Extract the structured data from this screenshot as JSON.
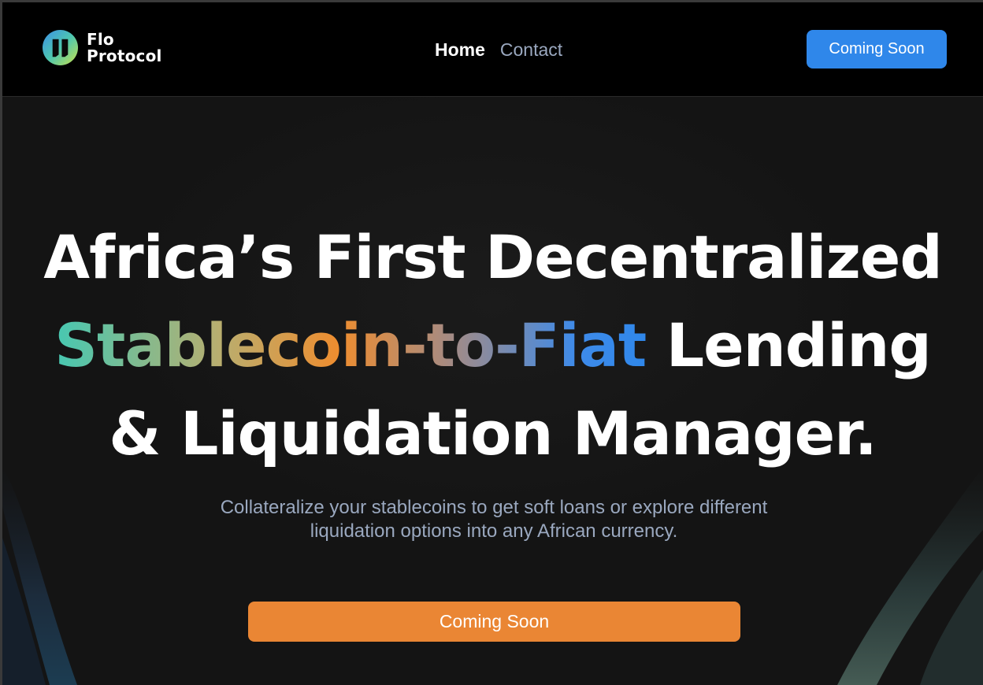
{
  "brand": {
    "name_line1": "Flo",
    "name_line2": "Protocol",
    "logo_icon": "flo-protocol-logo-icon"
  },
  "nav": {
    "items": [
      {
        "label": "Home",
        "active": true
      },
      {
        "label": "Contact",
        "active": false
      }
    ],
    "cta_label": "Coming Soon"
  },
  "hero": {
    "headline_line1": "Africa’s First Decentralized",
    "headline_highlight": "Stablecoin-to-Fiat",
    "headline_line2_rest": " Lending",
    "headline_line3": "& Liquidation Manager.",
    "subtitle": "Collateralize your stablecoins to get soft loans or explore different liquidation options into any African currency.",
    "cta_label": "Coming Soon"
  },
  "colors": {
    "nav_cta": "#2f87ea",
    "hero_cta": "#ea8634",
    "gradient_start": "#46c8b2",
    "gradient_mid": "#ee8d2f",
    "gradient_end": "#2f87ea",
    "muted_text": "#9aa8bf"
  }
}
